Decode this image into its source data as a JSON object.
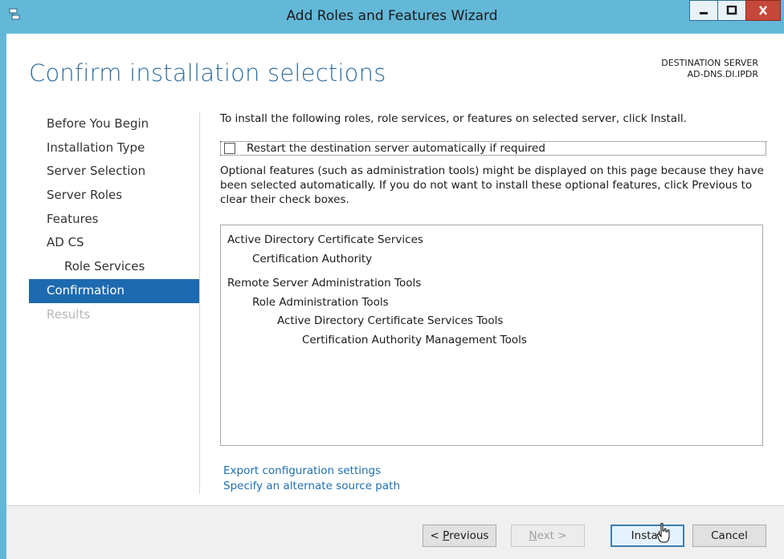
{
  "window": {
    "title": "Add Roles and Features Wizard",
    "accent_color": "#63b8d8",
    "icons": {
      "app": "server-manager-icon",
      "minimize": "minimize-icon",
      "maximize": "maximize-icon",
      "close": "close-icon"
    }
  },
  "header": {
    "page_title": "Confirm installation selections",
    "destination_label": "DESTINATION SERVER",
    "destination_server": "AD-DNS.DI.IPDR"
  },
  "sidebar": {
    "items": [
      {
        "label": "Before You Begin"
      },
      {
        "label": "Installation Type"
      },
      {
        "label": "Server Selection"
      },
      {
        "label": "Server Roles"
      },
      {
        "label": "Features"
      },
      {
        "label": "AD CS"
      },
      {
        "label": "Role Services"
      },
      {
        "label": "Confirmation"
      },
      {
        "label": "Results"
      }
    ],
    "active_color": "#1e6ab0"
  },
  "main": {
    "intro": "To install the following roles, role services, or features on selected server, click Install.",
    "restart_checkbox": {
      "label": "Restart the destination server automatically if required",
      "checked": false
    },
    "optional_note": "Optional features (such as administration tools) might be displayed on this page because they have been selected automatically. If you do not want to install these optional features, click Previous to clear their check boxes.",
    "selections": [
      {
        "text": "Active Directory Certificate Services"
      },
      {
        "text": "Certification Authority"
      },
      {
        "text": "Remote Server Administration Tools"
      },
      {
        "text": "Role Administration Tools"
      },
      {
        "text": "Active Directory Certificate Services Tools"
      },
      {
        "text": "Certification Authority Management Tools"
      }
    ],
    "links": {
      "export": "Export configuration settings",
      "alternate_source": "Specify an alternate source path"
    }
  },
  "footer": {
    "previous": {
      "prefix": "< ",
      "mnemonic": "P",
      "rest": "revious"
    },
    "next": {
      "mnemonic": "N",
      "rest": "ext >"
    },
    "install": "Install",
    "cancel": "Cancel"
  }
}
